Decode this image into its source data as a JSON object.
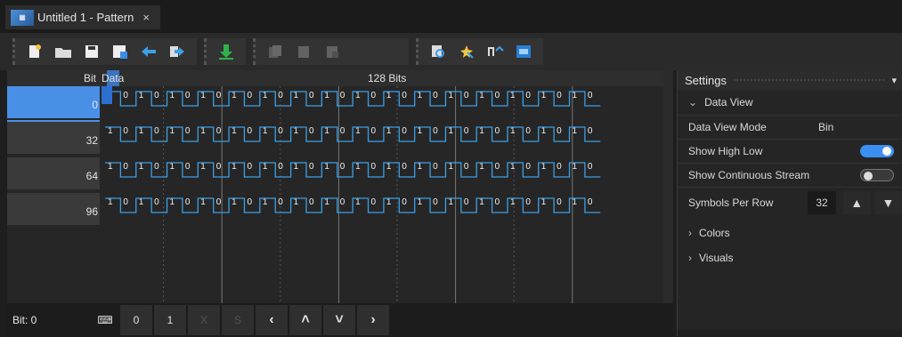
{
  "tab": {
    "title": "Untitled 1 - Pattern",
    "close": "×",
    "icon": "pattern-app-icon"
  },
  "toolbar": {
    "groups": [
      [
        "new-icon",
        "open-icon",
        "save-icon",
        "save-as-icon",
        "import-icon",
        "export-icon"
      ],
      [
        "download-icon"
      ],
      [
        "copy-icon",
        "paste-icon",
        "paste-special-icon"
      ],
      [
        "find-icon",
        "select-icon",
        "insert-icon",
        "export-data-icon"
      ]
    ]
  },
  "pattern": {
    "header_bit": "Bit",
    "header_data": "Data",
    "header_bits": "128 Bits",
    "rows": [
      {
        "label": "0",
        "bits": "10101010101010101010101010101010"
      },
      {
        "label": "32",
        "bits": "10101010101010101010101010101010"
      },
      {
        "label": "64",
        "bits": "10101010101010101010101010101010"
      },
      {
        "label": "96",
        "bits": "10101010101010101010101010101010"
      }
    ],
    "wave_color": "#3aa0e8",
    "selection_color": "#4a8fe6"
  },
  "bottombar": {
    "bit_readout": "Bit: 0",
    "keys": [
      "0",
      "1",
      "X",
      "S"
    ],
    "nav": [
      "<",
      "^",
      "v",
      ">"
    ]
  },
  "settings": {
    "title": "Settings",
    "data_view_section": "Data View",
    "data_view_mode_label": "Data View Mode",
    "data_view_mode_value": "Bin",
    "show_high_low_label": "Show High Low",
    "show_high_low": true,
    "show_continuous_label": "Show Continuous Stream",
    "show_continuous": false,
    "symbols_per_row_label": "Symbols Per Row",
    "symbols_per_row_value": "32",
    "colors_section": "Colors",
    "visuals_section": "Visuals"
  }
}
